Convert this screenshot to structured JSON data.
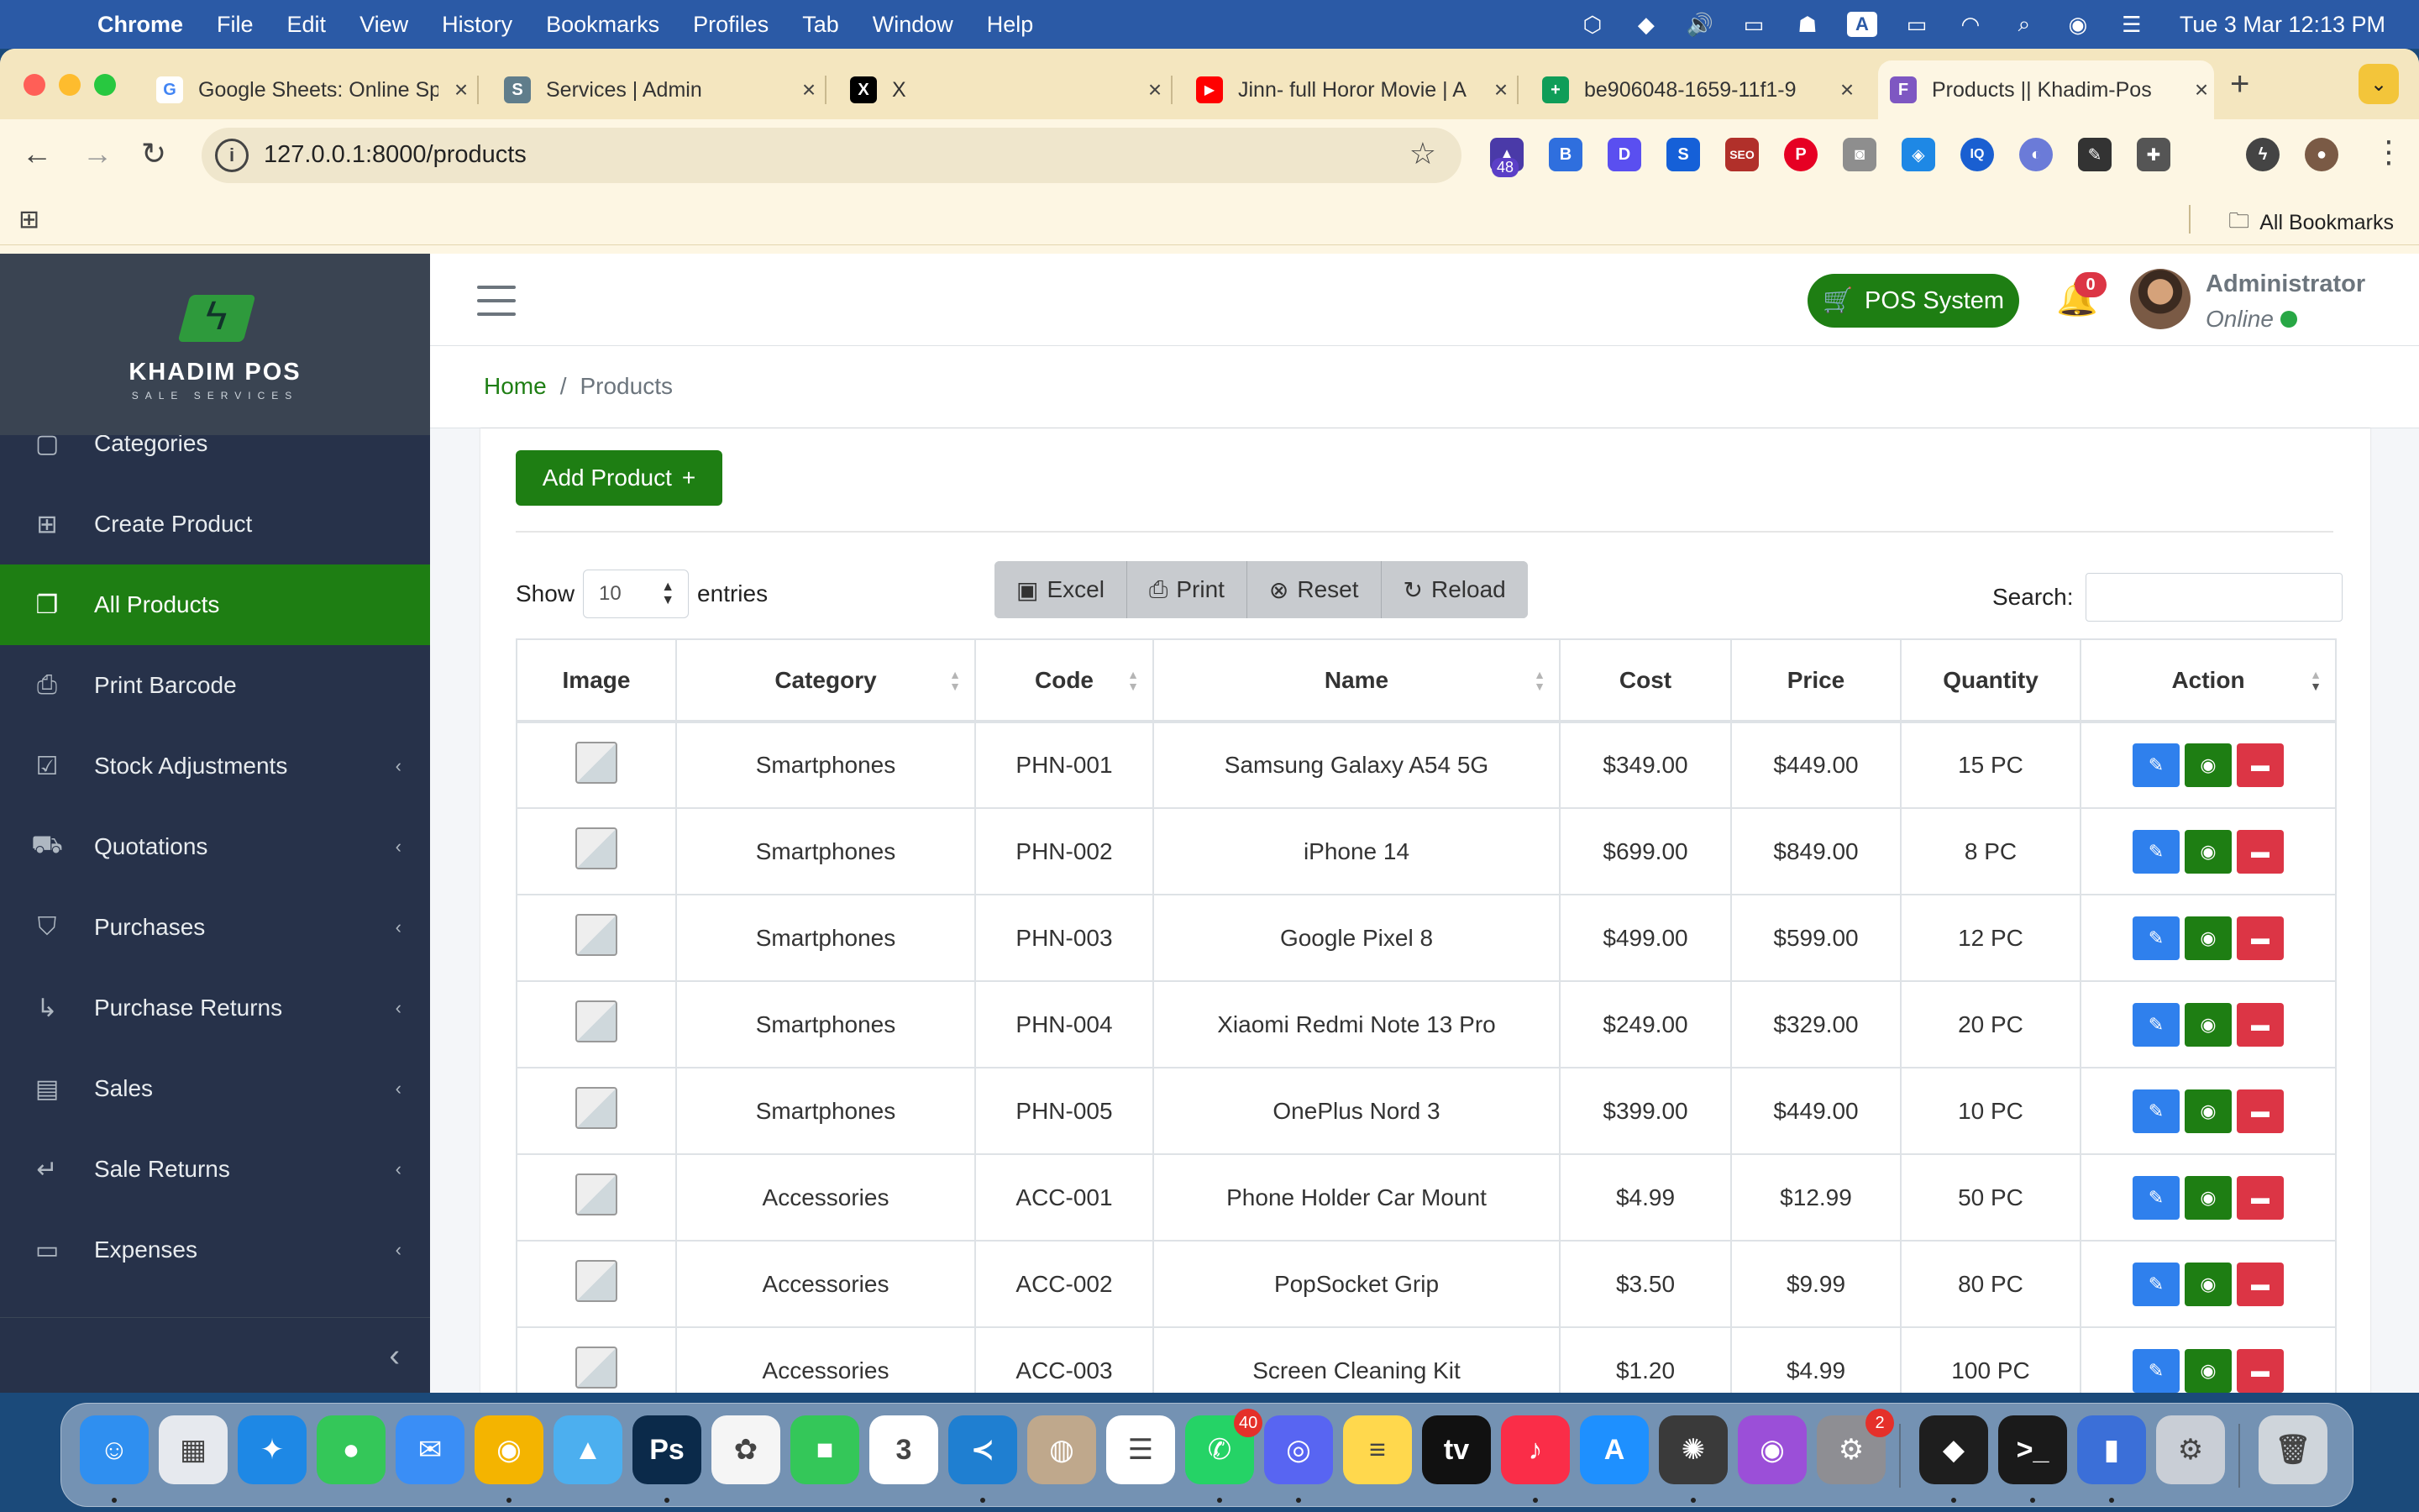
{
  "menubar": {
    "app": "Chrome",
    "items": [
      "File",
      "Edit",
      "View",
      "History",
      "Bookmarks",
      "Profiles",
      "Tab",
      "Window",
      "Help"
    ],
    "status_icons": [
      "cube-icon",
      "diamond-icon",
      "volume-icon",
      "display-icon",
      "accessibility-icon",
      "a-icon",
      "battery-icon",
      "wifi-icon",
      "search-icon",
      "siri-icon",
      "control-center-icon"
    ],
    "input_source": "A",
    "clock": "Tue 3 Mar  12:13 PM"
  },
  "browser": {
    "tabs": [
      {
        "title": "Google Sheets: Online Spreadsheet",
        "favicon": "G",
        "color": "#4285f4"
      },
      {
        "title": "Services | Admin",
        "favicon": "S",
        "color": "#607d8b"
      },
      {
        "title": "X",
        "favicon": "X",
        "color": "#000000"
      },
      {
        "title": "Jinn- full Horor Movie | A",
        "favicon": "▶",
        "color": "#ff0000"
      },
      {
        "title": "be906048-1659-11f1-9",
        "favicon": "+",
        "color": "#0f9d58"
      },
      {
        "title": "Products || Khadim-Pos",
        "favicon": "F",
        "color": "#7e57c2"
      }
    ],
    "url": "127.0.0.1:8000/products",
    "ext_badge": "48",
    "bookmarks_label": "All Bookmarks"
  },
  "sidebar": {
    "brand": "KHADIM POS",
    "brand_sub": "SALE SERVICES",
    "items": [
      {
        "label": "Categories",
        "icon": "square-icon",
        "chevron": ""
      },
      {
        "label": "Create Product",
        "icon": "plus-square-icon",
        "chevron": ""
      },
      {
        "label": "All Products",
        "icon": "copy-icon",
        "chevron": ""
      },
      {
        "label": "Print Barcode",
        "icon": "printer-icon",
        "chevron": ""
      },
      {
        "label": "Stock Adjustments",
        "icon": "clipboard-icon",
        "chevron": "‹"
      },
      {
        "label": "Quotations",
        "icon": "cart-icon",
        "chevron": "‹"
      },
      {
        "label": "Purchases",
        "icon": "bag-icon",
        "chevron": "‹"
      },
      {
        "label": "Purchase Returns",
        "icon": "return-icon",
        "chevron": "‹"
      },
      {
        "label": "Sales",
        "icon": "receipt-icon",
        "chevron": "‹"
      },
      {
        "label": "Sale Returns",
        "icon": "enter-icon",
        "chevron": "‹"
      },
      {
        "label": "Expenses",
        "icon": "wallet-icon",
        "chevron": "‹"
      }
    ]
  },
  "header": {
    "pos_button": "POS System",
    "notifications": "0",
    "user_name": "Administrator",
    "user_status": "Online"
  },
  "breadcrumb": {
    "home": "Home",
    "current": "Products"
  },
  "main": {
    "add_button": "Add Product",
    "show_label": "Show",
    "entries_value": "10",
    "entries_label": "entries",
    "buttons": [
      "Excel",
      "Print",
      "Reset",
      "Reload"
    ],
    "search_label": "Search:",
    "search_value": "",
    "columns": [
      "Image",
      "Category",
      "Code",
      "Name",
      "Cost",
      "Price",
      "Quantity",
      "Action"
    ],
    "rows": [
      {
        "category": "Smartphones",
        "code": "PHN-001",
        "name": "Samsung Galaxy A54 5G",
        "cost": "$349.00",
        "price": "$449.00",
        "quantity": "15 PC"
      },
      {
        "category": "Smartphones",
        "code": "PHN-002",
        "name": "iPhone 14",
        "cost": "$699.00",
        "price": "$849.00",
        "quantity": "8 PC"
      },
      {
        "category": "Smartphones",
        "code": "PHN-003",
        "name": "Google Pixel 8",
        "cost": "$499.00",
        "price": "$599.00",
        "quantity": "12 PC"
      },
      {
        "category": "Smartphones",
        "code": "PHN-004",
        "name": "Xiaomi Redmi Note 13 Pro",
        "cost": "$249.00",
        "price": "$329.00",
        "quantity": "20 PC"
      },
      {
        "category": "Smartphones",
        "code": "PHN-005",
        "name": "OnePlus Nord 3",
        "cost": "$399.00",
        "price": "$449.00",
        "quantity": "10 PC"
      },
      {
        "category": "Accessories",
        "code": "ACC-001",
        "name": "Phone Holder Car Mount",
        "cost": "$4.99",
        "price": "$12.99",
        "quantity": "50 PC"
      },
      {
        "category": "Accessories",
        "code": "ACC-002",
        "name": "PopSocket Grip",
        "cost": "$3.50",
        "price": "$9.99",
        "quantity": "80 PC"
      },
      {
        "category": "Accessories",
        "code": "ACC-003",
        "name": "Screen Cleaning Kit",
        "cost": "$1.20",
        "price": "$4.99",
        "quantity": "100 PC"
      }
    ]
  },
  "dock": {
    "apps": [
      {
        "name": "finder-icon",
        "color": "#2f8ff0",
        "glyph": "☺"
      },
      {
        "name": "launchpad-icon",
        "color": "#e6e9ee",
        "glyph": "▦"
      },
      {
        "name": "safari-icon",
        "color": "#1e88e5",
        "glyph": "✦"
      },
      {
        "name": "messages-icon",
        "color": "#34c759",
        "glyph": "●"
      },
      {
        "name": "mail-icon",
        "color": "#3a8ef6",
        "glyph": "✉"
      },
      {
        "name": "chrome-icon",
        "color": "#f4b400",
        "glyph": "◉"
      },
      {
        "name": "maps-icon",
        "color": "#4cafef",
        "glyph": "▲"
      },
      {
        "name": "photoshop-icon",
        "color": "#0b2a4a",
        "glyph": "Ps"
      },
      {
        "name": "photos-icon",
        "color": "#f5f5f5",
        "glyph": "✿"
      },
      {
        "name": "facetime-icon",
        "color": "#34c759",
        "glyph": "■"
      },
      {
        "name": "calendar-icon",
        "color": "#ffffff",
        "glyph": "3"
      },
      {
        "name": "vscode-icon",
        "color": "#1f7fd1",
        "glyph": "≺"
      },
      {
        "name": "contacts-icon",
        "color": "#bfa88c",
        "glyph": "◍"
      },
      {
        "name": "reminders-icon",
        "color": "#ffffff",
        "glyph": "☰"
      },
      {
        "name": "whatsapp-icon",
        "color": "#25d366",
        "glyph": "✆"
      },
      {
        "name": "discord-icon",
        "color": "#5865f2",
        "glyph": "◎"
      },
      {
        "name": "notes-icon",
        "color": "#ffd84d",
        "glyph": "≡"
      },
      {
        "name": "appletv-icon",
        "color": "#111111",
        "glyph": "tv"
      },
      {
        "name": "music-icon",
        "color": "#fa2d48",
        "glyph": "♪"
      },
      {
        "name": "appstore-icon",
        "color": "#1e90ff",
        "glyph": "A"
      },
      {
        "name": "chatgpt-icon",
        "color": "#3a3a3a",
        "glyph": "✺"
      },
      {
        "name": "podcasts-icon",
        "color": "#9b4fd8",
        "glyph": "◉"
      },
      {
        "name": "settings-icon",
        "color": "#8e8e93",
        "glyph": "⚙"
      },
      {
        "name": "cursor-icon",
        "color": "#1e1e1e",
        "glyph": "◆"
      },
      {
        "name": "terminal-icon",
        "color": "#1a1a1a",
        "glyph": ">_"
      },
      {
        "name": "simulator-icon",
        "color": "#3b6fd8",
        "glyph": "▮"
      },
      {
        "name": "utility-icon",
        "color": "#c9ced6",
        "glyph": "⚙"
      },
      {
        "name": "trash-icon",
        "color": "#cfd5db",
        "glyph": "🗑"
      }
    ],
    "badges": {
      "whatsapp": "40",
      "settings": "2"
    }
  }
}
